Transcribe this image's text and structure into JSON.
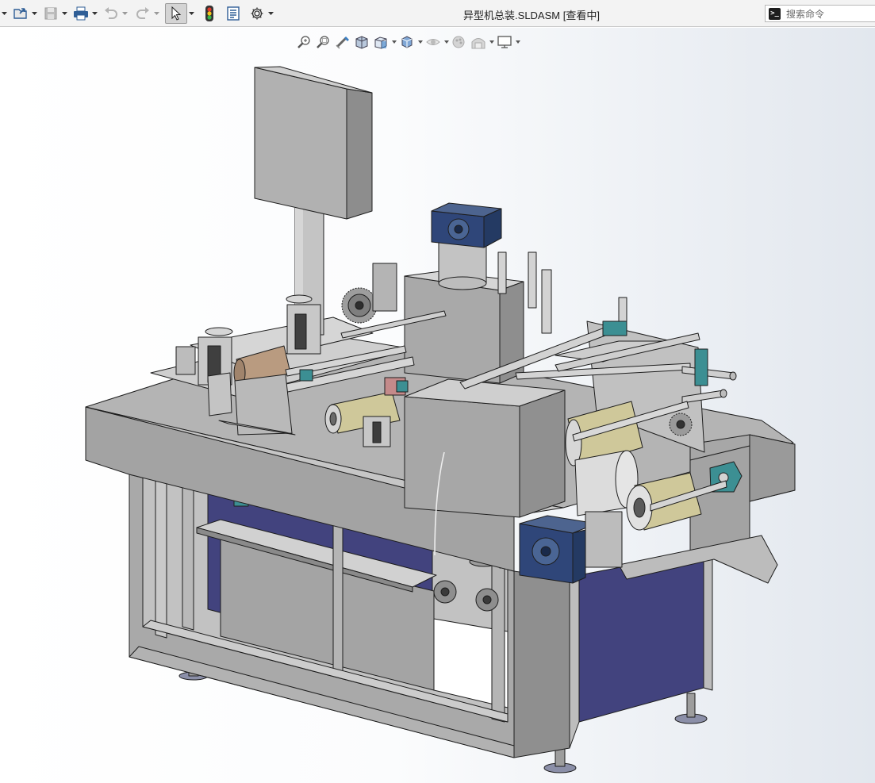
{
  "window": {
    "title": "异型机总装.SLDASM [查看中]"
  },
  "toolbar": {
    "buttons": [
      {
        "name": "new-document-dropdown",
        "icon": "dropdown-arrow-icon"
      },
      {
        "name": "open-button",
        "icon": "open-folder-icon"
      },
      {
        "name": "save-button",
        "icon": "save-icon",
        "disabled": true
      },
      {
        "name": "print-button",
        "icon": "print-icon"
      },
      {
        "name": "undo-button",
        "icon": "undo-icon",
        "disabled": true
      },
      {
        "name": "redo-button",
        "icon": "redo-icon",
        "disabled": true
      },
      {
        "name": "select-button",
        "icon": "select-arrow-icon",
        "active": true
      },
      {
        "name": "rebuild-button",
        "icon": "traffic-light-icon"
      },
      {
        "name": "file-properties-button",
        "icon": "file-properties-icon"
      },
      {
        "name": "options-button",
        "icon": "gear-icon"
      }
    ]
  },
  "search": {
    "placeholder": "搜索命令"
  },
  "heads_up_toolbar": {
    "items": [
      "zoom-to-fit-icon",
      "zoom-to-area-icon",
      "previous-view-icon",
      "section-view-icon",
      "view-orientation-icon",
      "display-style-icon",
      "hide-show-items-icon",
      "edit-appearance-icon",
      "apply-scene-icon",
      "view-settings-icon"
    ]
  },
  "model": {
    "name": "异型机总装",
    "colors": {
      "frame": "#a9a9a9",
      "frame_dark": "#7d7d7d",
      "frame_light": "#c4c4c4",
      "panel_blue": "#42437e",
      "motor_blue": "#2f4679",
      "roller_beige": "#cfc89a",
      "roller_brown": "#b99b80",
      "teal": "#3c8f93",
      "background_end": "#e2e7ee"
    }
  }
}
